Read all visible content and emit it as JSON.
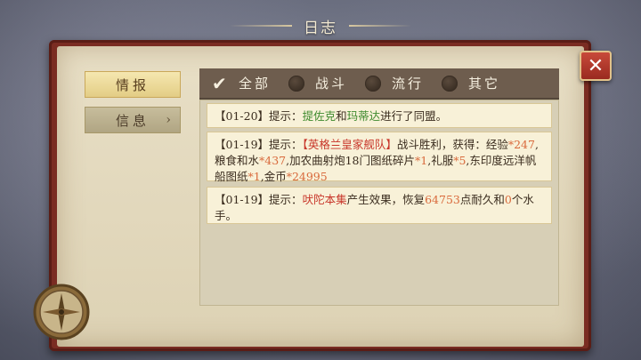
{
  "window": {
    "title": "日志"
  },
  "sidebar": {
    "items": [
      {
        "label": "情报",
        "active": true
      },
      {
        "label": "信息",
        "active": false,
        "arrow": "chevron-right-icon"
      }
    ]
  },
  "tabs": [
    {
      "label": "全部",
      "selected": true
    },
    {
      "label": "战斗",
      "selected": false
    },
    {
      "label": "流行",
      "selected": false
    },
    {
      "label": "其它",
      "selected": false
    }
  ],
  "logs": [
    {
      "date": "【01-20】",
      "prefix": "提示：",
      "name1": "提佐克",
      "mid": "和",
      "name2": "玛蒂达",
      "tail": "进行了同盟。"
    },
    {
      "date": "【01-19】",
      "prefix": "提示：",
      "fleet": "【英格兰皇家舰队】",
      "t1": "战斗胜利，获得：经验",
      "exp": "*247",
      "t2": ",粮食和水",
      "food": "*437",
      "t3": ",加农曲射炮18门图纸碎片",
      "frag": "*1",
      "t4": ",礼服",
      "suit": "*5",
      "t5": ",东印度远洋帆船图纸",
      "ship": "*1",
      "t6": ",金币",
      "gold": "*24995"
    },
    {
      "date": "【01-19】",
      "prefix": "提示：",
      "item": "吠陀本集",
      "t1": "产生效果，恢复",
      "num": "64753",
      "t2": "点耐久和",
      "zero": "0",
      "t3": "个水手。"
    }
  ],
  "close": {
    "label": "✕",
    "icon": "close-icon"
  },
  "colors": {
    "green": "#3f8a2e",
    "red": "#c8362a",
    "orange": "#d96a3c",
    "cover": "#7a2c22"
  }
}
